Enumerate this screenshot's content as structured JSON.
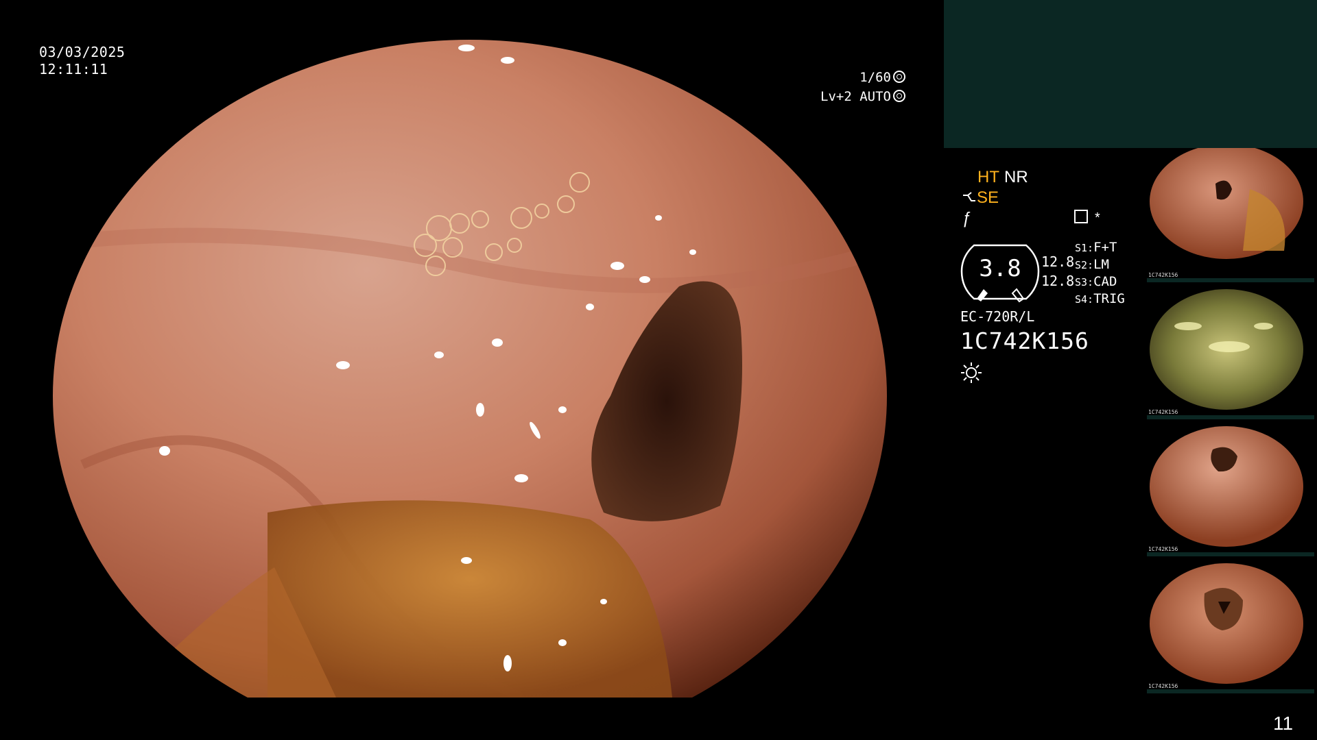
{
  "overlay": {
    "date": "03/03/2025",
    "time": "12:11:11",
    "shutter": "1/60",
    "level": "Lv+2",
    "exposure_mode": "AUTO"
  },
  "modes": {
    "ht": "HT",
    "nr": "NR",
    "se": "SE",
    "f_symbol": "ƒ",
    "star": "*"
  },
  "gauge": {
    "value": "3.8",
    "side_top": "12.8",
    "side_bottom": "12.8"
  },
  "scope_settings": [
    {
      "key": "S1:",
      "value": "F+T"
    },
    {
      "key": "S2:",
      "value": "LM"
    },
    {
      "key": "S3:",
      "value": "CAD"
    },
    {
      "key": "S4:",
      "value": "TRIG"
    }
  ],
  "device": {
    "model": "EC-720R/L",
    "serial": "1C742K156"
  },
  "thumbnails": [
    {
      "caption": "1C742K156",
      "tone": "mucosa"
    },
    {
      "caption": "1C742K156",
      "tone": "flush"
    },
    {
      "caption": "1C742K156",
      "tone": "mucosa"
    },
    {
      "caption": "1C742K156",
      "tone": "mucosa"
    }
  ],
  "page_number": "11",
  "colors": {
    "accent_orange": "#ffb21e",
    "panel_teal": "#0b2723",
    "background": "#000000"
  }
}
